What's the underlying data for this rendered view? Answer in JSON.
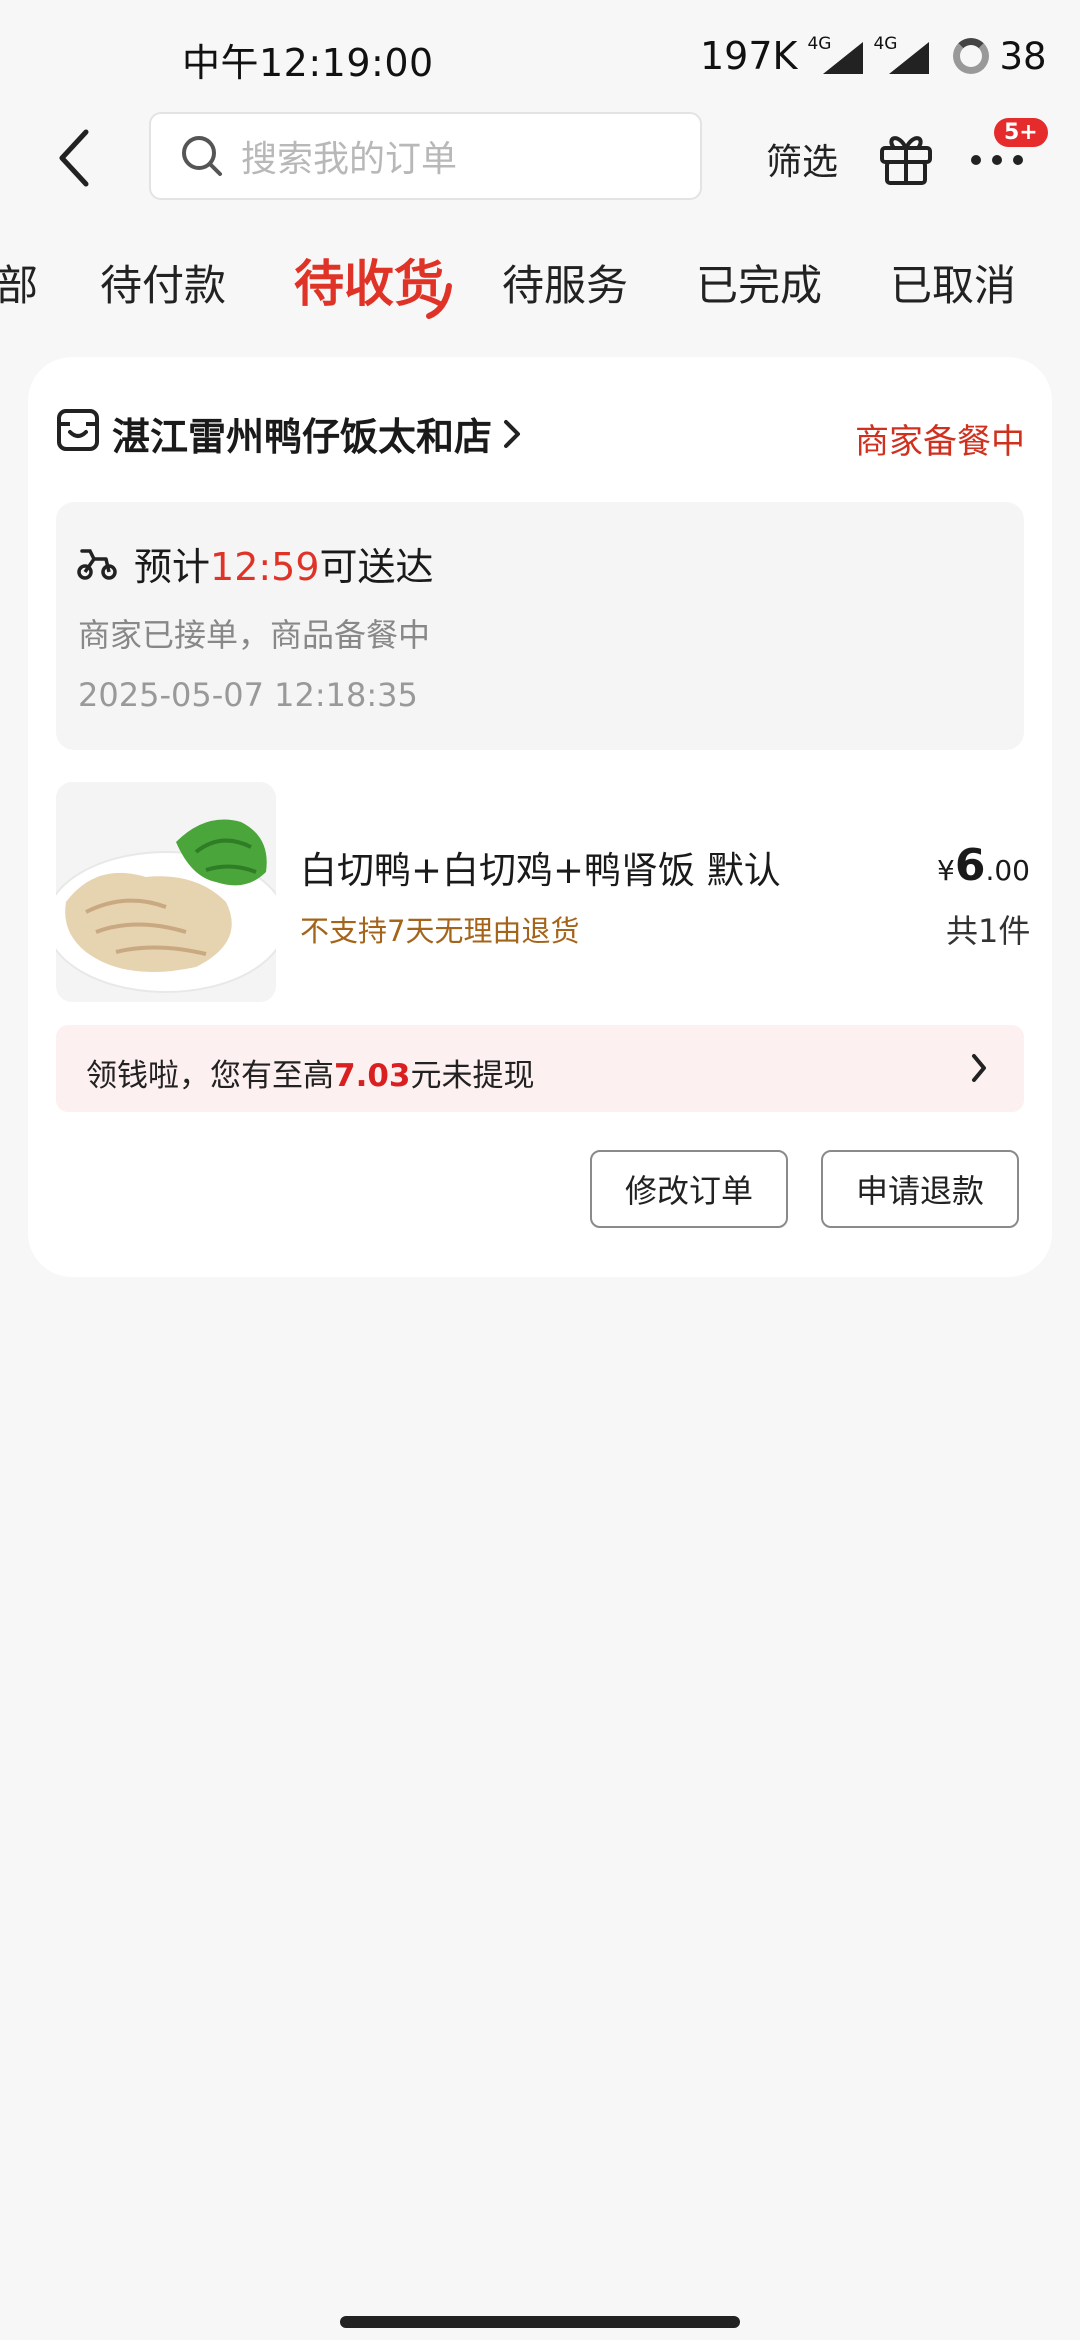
{
  "status_bar": {
    "time": "中午12:19:00",
    "net_speed": "197K",
    "signal_1_tag": "4G",
    "signal_2_tag": "4G",
    "battery": "38"
  },
  "header": {
    "search_placeholder": "搜索我的订单",
    "filter_label": "筛选",
    "more_badge": "5+"
  },
  "tabs": [
    {
      "label": "部",
      "active": false
    },
    {
      "label": "待付款",
      "active": false
    },
    {
      "label": "待收货",
      "active": true
    },
    {
      "label": "待服务",
      "active": false
    },
    {
      "label": "已完成",
      "active": false
    },
    {
      "label": "已取消",
      "active": false
    }
  ],
  "order": {
    "shop_name": "湛江雷州鸭仔饭太和店",
    "status": "商家备餐中",
    "delivery": {
      "eta_prefix": "预计",
      "eta_time": "12:59",
      "eta_suffix": "可送达",
      "progress": "商家已接单，商品备餐中",
      "timestamp": "2025-05-07 12:18:35"
    },
    "item": {
      "name": "白切鸭+白切鸡+鸭肾饭 默认",
      "policy": "不支持7天无理由退货",
      "price_symbol": "¥",
      "price_int": "6",
      "price_dec": ".00",
      "quantity": "共1件"
    },
    "promo": {
      "prefix": "领钱啦，您有至高",
      "amount": "7.03",
      "suffix": "元未提现"
    },
    "actions": {
      "modify_label": "修改订单",
      "refund_label": "申请退款"
    }
  },
  "colors": {
    "accent_red": "#e03327",
    "policy_brown": "#a4641a",
    "promo_bg": "#fdf0f0"
  }
}
